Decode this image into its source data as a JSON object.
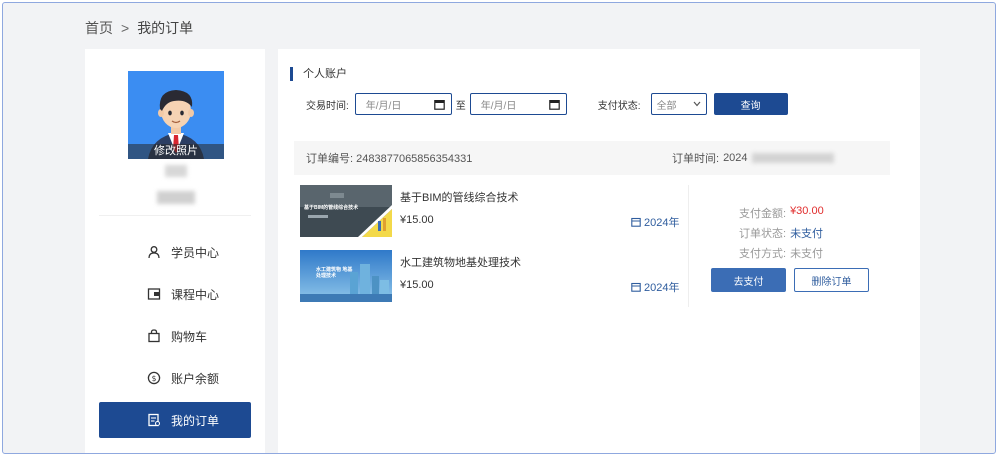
{
  "breadcrumb": {
    "home": "首页",
    "separator": ">",
    "current": "我的订单"
  },
  "profile": {
    "edit_photo": "修改照片"
  },
  "sidebar": {
    "items": [
      {
        "label": "学员中心",
        "icon": "user-icon",
        "active": false
      },
      {
        "label": "课程中心",
        "icon": "course-icon",
        "active": false
      },
      {
        "label": "购物车",
        "icon": "shopping-bag-icon",
        "active": false
      },
      {
        "label": "账户余额",
        "icon": "coin-icon",
        "active": false
      },
      {
        "label": "我的订单",
        "icon": "order-icon",
        "active": true
      }
    ]
  },
  "main": {
    "section_title": "个人账户"
  },
  "filters": {
    "date_label": "交易时间:",
    "date_from_placeholder": "年/月/日",
    "date_to_label": "至",
    "date_to_placeholder": "年/月/日",
    "status_label": "支付状态:",
    "status_value": "全部",
    "query_button": "查询"
  },
  "order": {
    "number_label": "订单编号:",
    "number": "2483877065856354331",
    "time_label": "订单时间:",
    "time_visible": "2024",
    "courses": [
      {
        "title": "基于BIM的管线综合技术",
        "price": "¥15.00",
        "year": "2024年",
        "thumb_text": "基于BIM的管线综合技术"
      },
      {
        "title": "水工建筑物地基处理技术",
        "price": "¥15.00",
        "year": "2024年",
        "thumb_text": "水工建筑物 地基处理技术"
      }
    ],
    "payment": {
      "amount_label": "支付金额:",
      "amount": "¥30.00",
      "status_label": "订单状态:",
      "status": "未支付",
      "method_label": "支付方式:",
      "method": "未支付",
      "pay_button": "去支付",
      "delete_button": "删除订单"
    }
  },
  "colors": {
    "primary": "#1d4a92",
    "accent_blue": "#3b6db5",
    "price_red": "#e12d2d",
    "avatar_bg": "#3b8df2"
  }
}
